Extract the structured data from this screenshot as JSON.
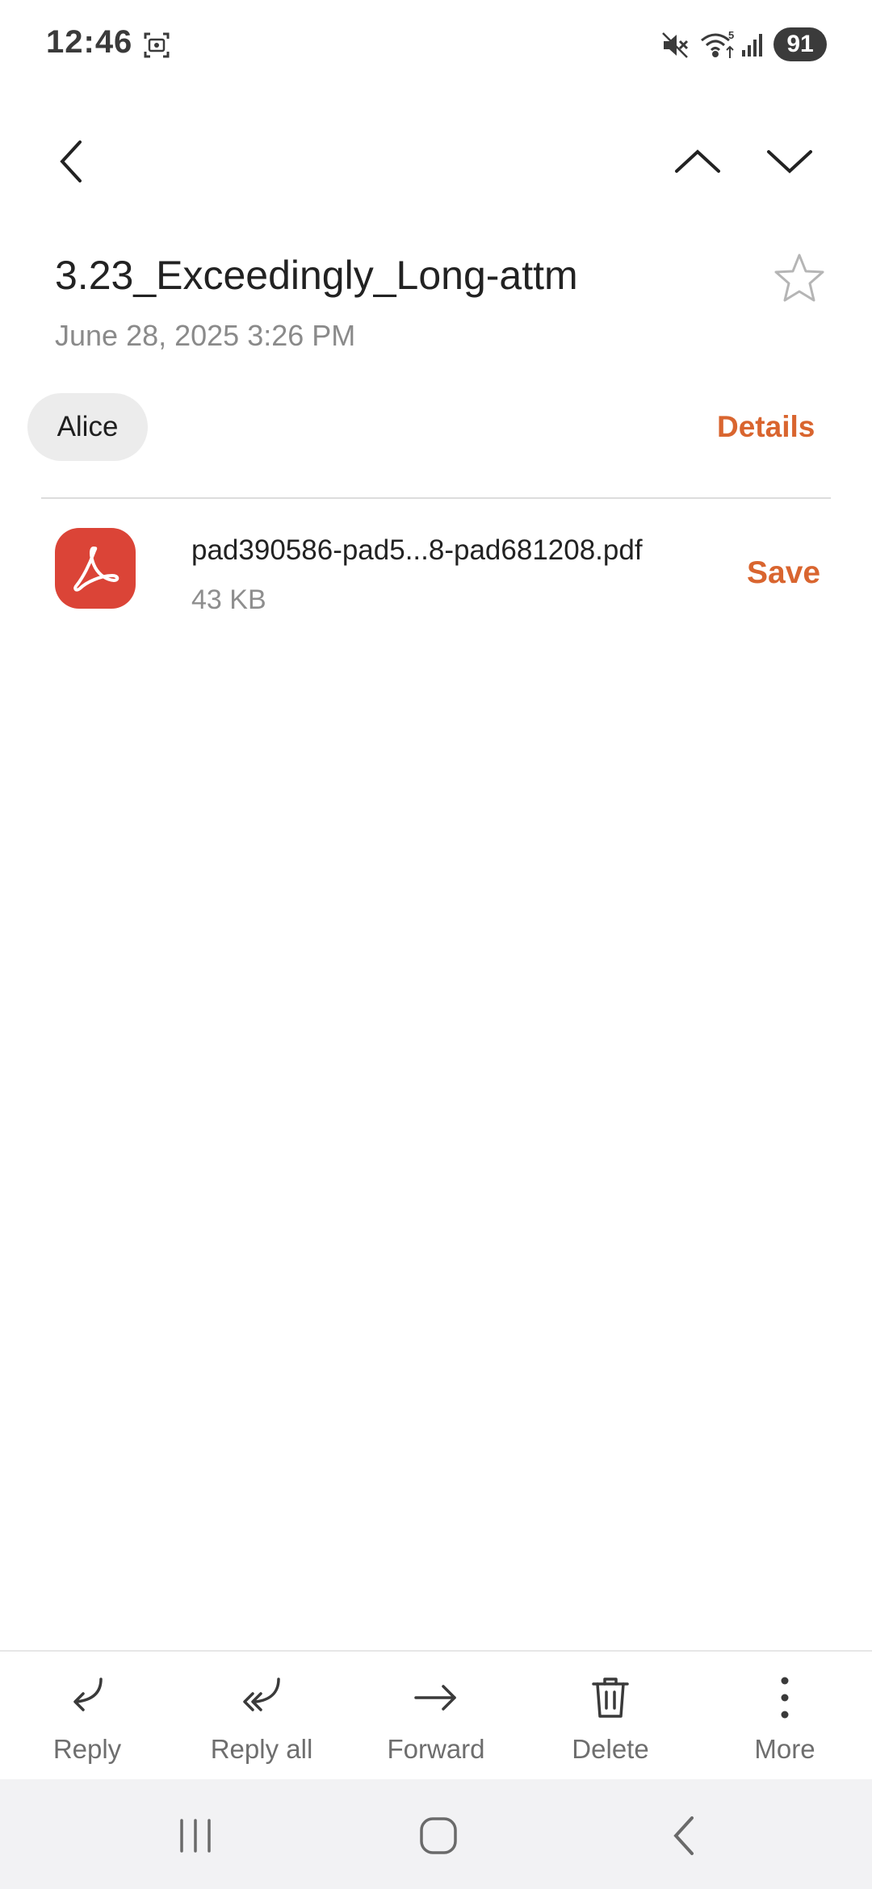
{
  "status_bar": {
    "time": "12:46",
    "battery": "91",
    "icons": [
      "screenshot-icon",
      "mute-icon",
      "wifi-icon",
      "signal-icon"
    ]
  },
  "top_nav": {
    "icons": [
      "back-arrow-icon",
      "chevron-up-icon",
      "chevron-down-icon"
    ]
  },
  "email": {
    "subject": "3.23_Exceedingly_Long-attm",
    "date": "June 28, 2025  3:26 PM",
    "sender": "Alice",
    "details_label": "Details"
  },
  "attachment": {
    "icon": "pdf-icon",
    "file_name": "pad390586-pad5...8-pad681208.pdf",
    "file_size": "43 KB",
    "save_label": "Save"
  },
  "actions": {
    "reply": "Reply",
    "reply_all": "Reply all",
    "forward": "Forward",
    "delete": "Delete",
    "more": "More"
  },
  "colors": {
    "accent": "#d9652f",
    "pdf_red": "#db4437",
    "chip_bg": "#ececec"
  }
}
